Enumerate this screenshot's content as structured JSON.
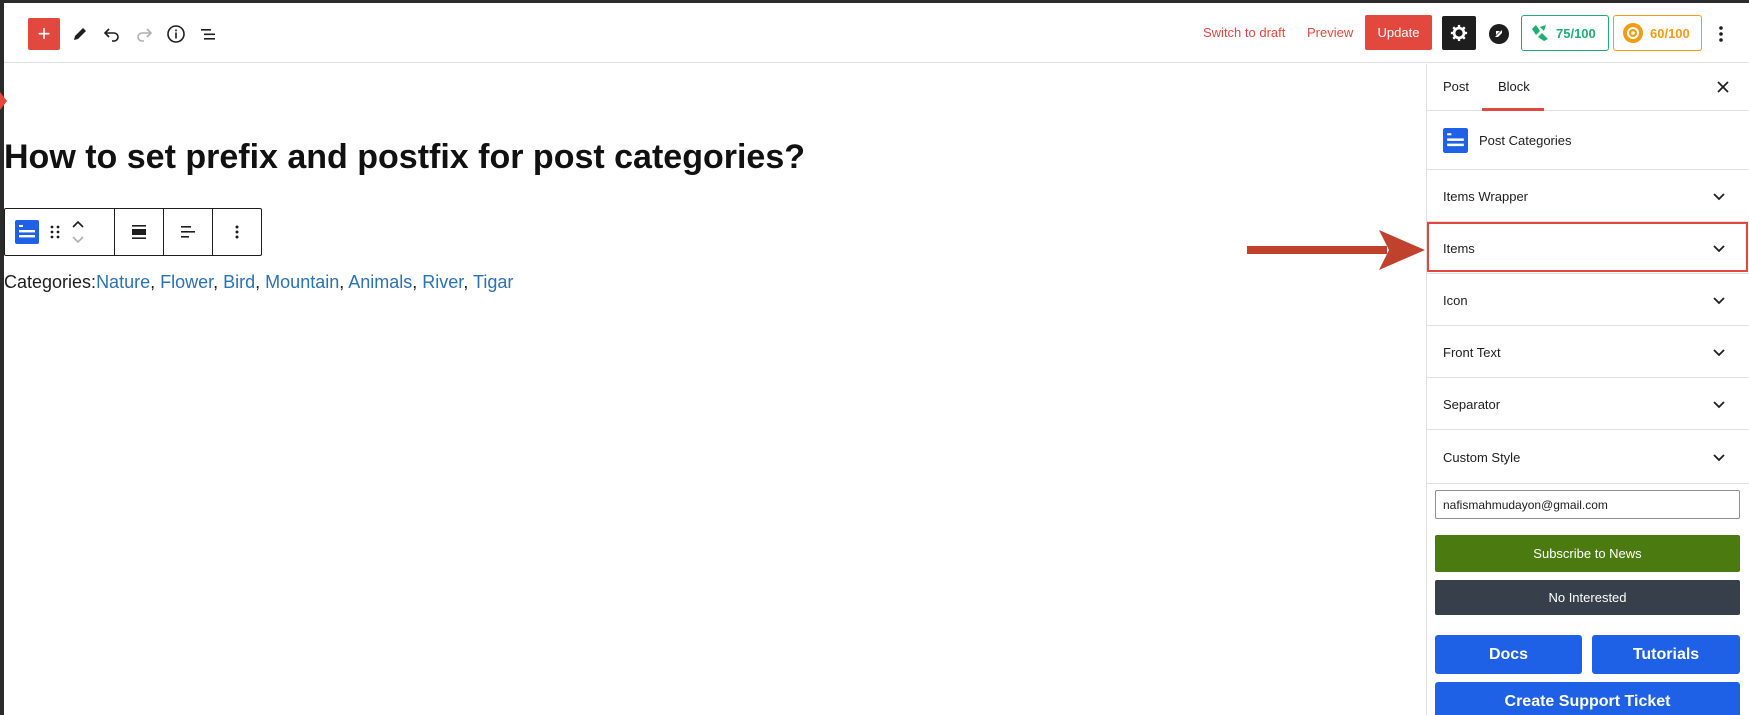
{
  "toolbar": {
    "add_glyph": "+",
    "switch_to_draft": "Switch to draft",
    "preview": "Preview",
    "update": "Update",
    "score_green": "75/100",
    "score_orange": "60/100",
    "icons": [
      "plus-icon",
      "pencil-icon",
      "undo-icon",
      "redo-icon",
      "info-icon",
      "list-view-icon",
      "gear-icon",
      "more-vertical-icon"
    ]
  },
  "editor": {
    "title": "How to set prefix and postfix for post categories?",
    "categories_label": "Categories:",
    "categories": [
      "Nature",
      "Flower",
      "Bird",
      "Mountain",
      "Animals",
      "River",
      "Tigar"
    ],
    "separator": ", "
  },
  "sidebar": {
    "tabs": [
      {
        "label": "Post"
      },
      {
        "label": "Block",
        "active": true
      }
    ],
    "block_name": "Post Categories",
    "panels": [
      {
        "label": "Items Wrapper"
      },
      {
        "label": "Items",
        "highlighted": true
      },
      {
        "label": "Icon"
      },
      {
        "label": "Front Text"
      },
      {
        "label": "Separator"
      },
      {
        "label": "Custom Style"
      }
    ],
    "email_value": "nafismahmudayon@gmail.com",
    "subscribe_label": "Subscribe to News",
    "not_interested_label": "No Interested",
    "docs_label": "Docs",
    "tutorials_label": "Tutorials",
    "support_label": "Create Support Ticket"
  },
  "colors": {
    "accent": "#e2483d",
    "link": "#2a72b5",
    "subscribe": "#4b7a11",
    "dark_button": "#373f4b",
    "blue_button": "#1f61e6",
    "score_green": "#1fae72",
    "score_orange": "#f39c12"
  }
}
